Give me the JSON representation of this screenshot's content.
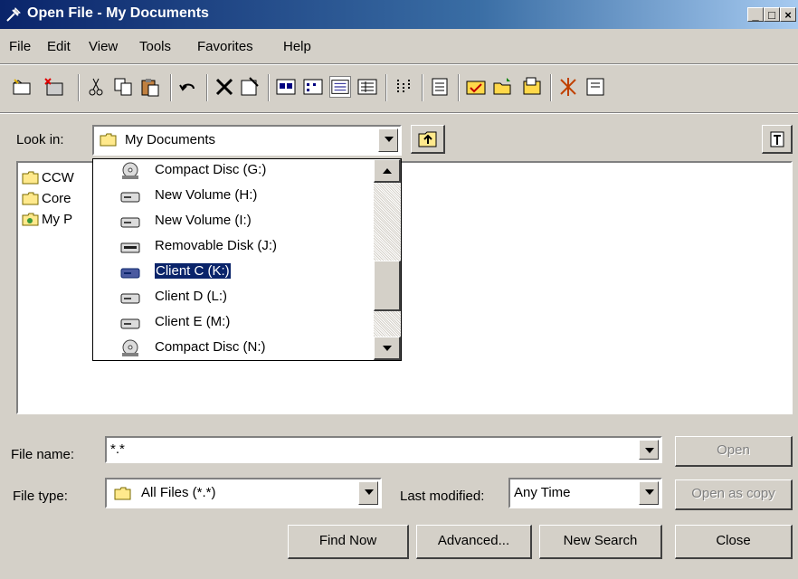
{
  "window": {
    "title": "Open File - My Documents"
  },
  "menu": [
    {
      "label": "File"
    },
    {
      "label": "Edit"
    },
    {
      "label": "View"
    },
    {
      "label": "Tools"
    },
    {
      "label": "Favorites"
    },
    {
      "label": "Help"
    }
  ],
  "look_in": {
    "label": "Look in:",
    "value": "My Documents"
  },
  "file_list": [
    {
      "name": "CCW",
      "icon": "folder-icon"
    },
    {
      "name": "Core",
      "icon": "folder-icon"
    },
    {
      "name": "My P",
      "icon": "my-pictures-icon"
    }
  ],
  "drive_list": [
    {
      "label": "Compact Disc (G:)",
      "icon": "cd-icon"
    },
    {
      "label": "New Volume (H:)",
      "icon": "hard-drive-icon"
    },
    {
      "label": "New Volume (I:)",
      "icon": "hard-drive-icon"
    },
    {
      "label": "Removable Disk (J:)",
      "icon": "removable-disk-icon"
    },
    {
      "label": "Client C (K:)",
      "icon": "hard-drive-icon",
      "selected": true
    },
    {
      "label": "Client D (L:)",
      "icon": "hard-drive-icon"
    },
    {
      "label": "Client E (M:)",
      "icon": "hard-drive-icon"
    },
    {
      "label": "Compact Disc (N:)",
      "icon": "cd-icon"
    }
  ],
  "file_name": {
    "label": "File name:",
    "value": "*.*"
  },
  "file_type": {
    "label": "File type:",
    "value": "All Files (*.*)"
  },
  "last_modified": {
    "label": "Last modified:",
    "value": "Any Time"
  },
  "buttons": {
    "open": "Open",
    "open_as_copy": "Open as copy",
    "find_now": "Find Now",
    "advanced": "Advanced...",
    "new_search": "New Search",
    "close": "Close"
  }
}
